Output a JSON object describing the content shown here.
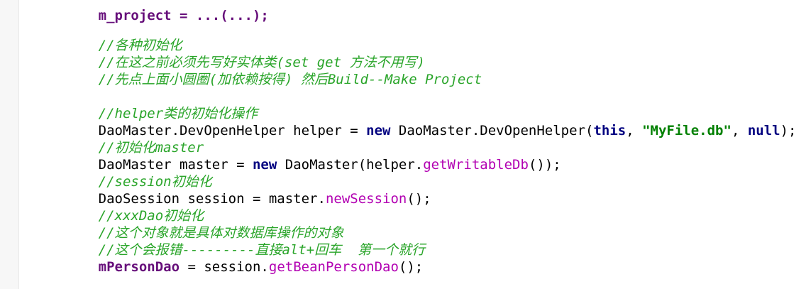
{
  "top_partial": "m_project = ...(...);",
  "comments": {
    "c1": "//各种初始化",
    "c2": "//在这之前必须先写好实体类(set get 方法不用写)",
    "c3": "//先点上面小圆圈(加依赖按得) 然后Build--Make Project",
    "c4": "//helper类的初始化操作",
    "c5": "//初始化master",
    "c6": "//session初始化",
    "c7": "//xxxDao初始化",
    "c8": "//这个对象就是具体对数据库操作的对象",
    "c9": "//这个会报错---------直接alt+回车  第一个就行"
  },
  "line1": {
    "type": "DaoMaster.DevOpenHelper helper = ",
    "new": "new",
    "ctor": " DaoMaster.DevOpenHelper(",
    "this": "this",
    "comma1": ", ",
    "db": "\"MyFile.db\"",
    "comma2": ", ",
    "null": "null",
    "end": ");"
  },
  "line2": {
    "type": "DaoMaster master = ",
    "new": "new",
    "ctor": " DaoMaster(helper.",
    "method": "getWritableDb",
    "end": "());"
  },
  "line3": {
    "type": "DaoSession session = master.",
    "method": "newSession",
    "end": "();"
  },
  "line4": {
    "field": "mPersonDao",
    "mid": " = session.",
    "method": "getBeanPersonDao",
    "end": "();"
  }
}
